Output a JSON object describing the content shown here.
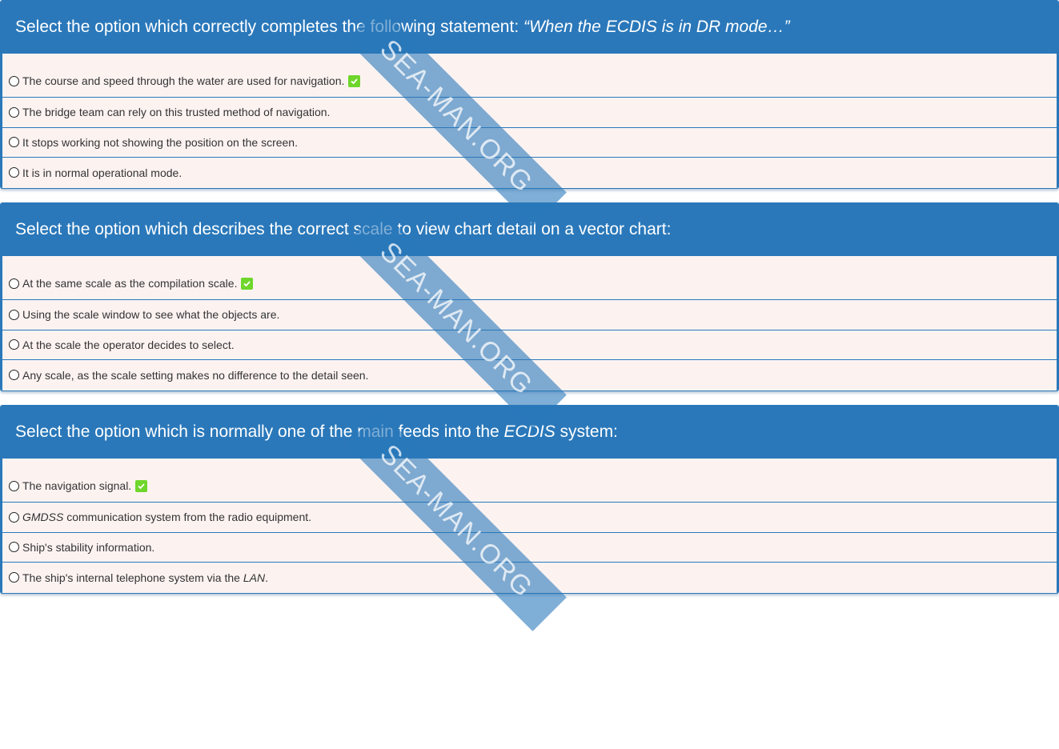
{
  "questions": [
    {
      "prompt_plain": "Select the option which correctly completes the following statement: ",
      "prompt_italic": "“When the ECDIS is in DR mode…”",
      "prompt_tail": "",
      "answers": [
        {
          "text": "The course and speed through the water are used for navigation.",
          "correct": true
        },
        {
          "text": "The bridge team can rely on this trusted method of navigation.",
          "correct": false
        },
        {
          "text": "It stops working not showing the position on the screen.",
          "correct": false
        },
        {
          "text": "It is in normal operational mode.",
          "correct": false
        }
      ]
    },
    {
      "prompt_plain": "Select the option which describes the correct scale to view chart detail on a vector chart:",
      "prompt_italic": "",
      "prompt_tail": "",
      "answers": [
        {
          "text": "At the same scale as the compilation scale.",
          "correct": true
        },
        {
          "text": "Using the scale window to see what the objects are.",
          "correct": false
        },
        {
          "text": "At the scale the operator decides to select.",
          "correct": false
        },
        {
          "text": "Any scale, as the scale setting makes no difference to the detail seen.",
          "correct": false
        }
      ]
    },
    {
      "prompt_plain": "Select the option which is normally one of the main feeds into the ",
      "prompt_italic": "ECDIS",
      "prompt_tail": " system:",
      "answers": [
        {
          "text": "The navigation signal.",
          "correct": true
        },
        {
          "italic_prefix": "GMDSS",
          "text": " communication system from the radio equipment.",
          "correct": false
        },
        {
          "text": "Ship's stability information.",
          "correct": false
        },
        {
          "text": "The ship's internal telephone system via the ",
          "italic_suffix": "LAN",
          "suffix": ".",
          "correct": false
        }
      ]
    }
  ],
  "watermark": "SEA-MAN.ORG",
  "icons": {
    "radio": "radio-button-icon",
    "correct": "checkmark-icon"
  },
  "colors": {
    "header": "#2a78ba",
    "answer_bg": "#fcf3f1",
    "correct_badge": "#6fd62b"
  }
}
